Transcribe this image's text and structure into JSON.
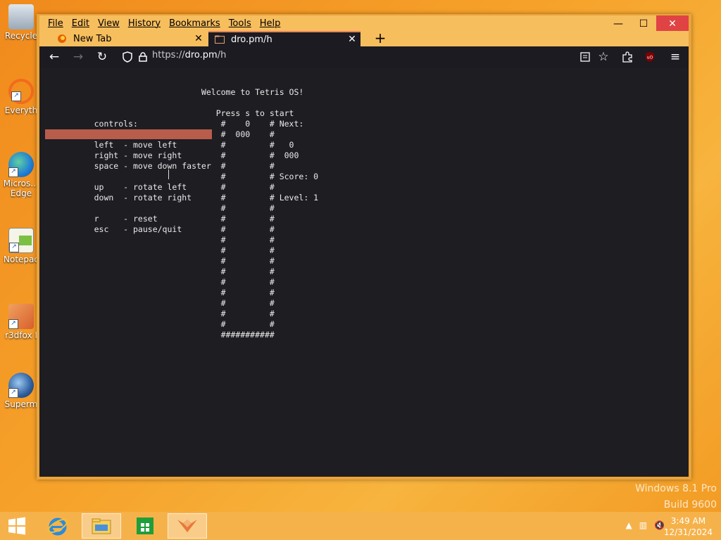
{
  "desktop": {
    "icons": [
      {
        "label": "Recycle"
      },
      {
        "label": "Everyth"
      },
      {
        "label": "Micros…\nEdge"
      },
      {
        "label": "Notepac"
      },
      {
        "label": "r3dfox I"
      },
      {
        "label": "Superm"
      }
    ],
    "watermark": {
      "line1": "Windows 8.1 Pro",
      "line2": "Build 9600"
    }
  },
  "browser": {
    "menu": [
      "File",
      "Edit",
      "View",
      "History",
      "Bookmarks",
      "Tools",
      "Help"
    ],
    "tabs": [
      {
        "label": "New Tab",
        "icon": "firefox-icon",
        "active": false
      },
      {
        "label": "dro.pm/h",
        "icon": "page-icon",
        "active": true
      }
    ],
    "url": {
      "scheme": "https://",
      "host": "dro.pm",
      "path": "/h"
    }
  },
  "terminal": {
    "lines": [
      "                           Welcome to Tetris OS!",
      "",
      "                              Press s to start",
      "     controls:                 #    0    # Next:",
      "                               #  000    #",
      "     left  - move left         #         #   0",
      "     right - move right        #         #  000",
      "     space - move down faster  #         #",
      "                               #         # Score: 0",
      "     up    - rotate left       #         #",
      "     down  - rotate right      #         # Level: 1",
      "                               #         #",
      "     r     - reset             #         #",
      "     esc   - pause/quit        #         #",
      "                               #         #",
      "                               #         #",
      "                               #         #",
      "                               #         #",
      "                               #         #",
      "                               #         #",
      "                               #         #",
      "                               #         #",
      "                               #         #",
      "                               ###########"
    ]
  },
  "taskbar": {
    "items": [
      "ie-icon",
      "file-explorer-icon",
      "store-icon",
      "firefox-icon"
    ],
    "clock": {
      "time": "3:49 AM",
      "date": "12/31/2024"
    }
  }
}
